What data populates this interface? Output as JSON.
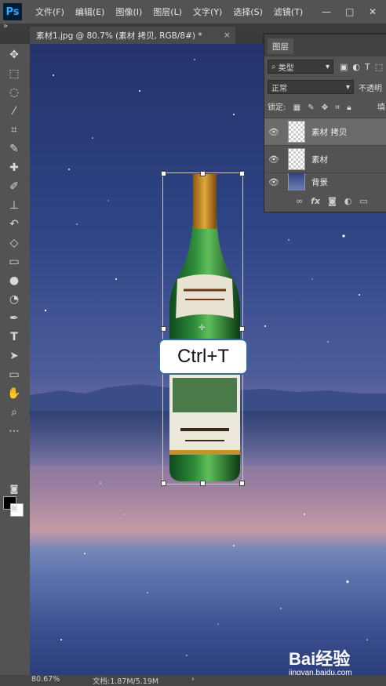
{
  "menubar": {
    "logo": "Ps",
    "items": [
      "文件(F)",
      "编辑(E)",
      "图像(I)",
      "图层(L)",
      "文字(Y)",
      "选择(S)",
      "滤镜(T)"
    ],
    "minimize": "—",
    "restore": "□",
    "close": "✕"
  },
  "toolbar": {
    "collapse": "»",
    "tools": [
      "move-tool-icon",
      "marquee-tool-icon",
      "lasso-tool-icon",
      "quick-select-tool-icon",
      "crop-tool-icon",
      "eyedropper-tool-icon",
      "healing-brush-tool-icon",
      "brush-tool-icon",
      "stamp-tool-icon",
      "history-brush-tool-icon",
      "eraser-tool-icon",
      "gradient-tool-icon",
      "blur-tool-icon",
      "dodge-tool-icon",
      "pen-tool-icon",
      "type-tool-icon",
      "path-select-tool-icon",
      "rectangle-tool-icon",
      "hand-tool-icon",
      "zoom-tool-icon",
      "more-tools-icon"
    ]
  },
  "document": {
    "tab_title": "素材1.jpg @ 80.7% (素材 拷贝, RGB/8#) *",
    "tab_close": "×"
  },
  "overlay": {
    "shortcut": "Ctrl+T"
  },
  "layers_panel": {
    "tab": "图层",
    "filter_label": "类型",
    "blend_mode": "正常",
    "opacity_label": "不透明",
    "lock_label": "锁定:",
    "fill_label": "填",
    "layers": [
      {
        "name": "素材 拷贝",
        "selected": true
      },
      {
        "name": "素材",
        "selected": false
      },
      {
        "name": "背景",
        "selected": false
      }
    ],
    "footer_icons": [
      "link-icon",
      "fx-icon",
      "mask-icon",
      "adjustment-icon",
      "folder-icon"
    ]
  },
  "statusbar": {
    "zoom": "80.67%",
    "doc_info": "文档:1.87M/5.19M"
  },
  "watermark": {
    "brand": "Bai经验",
    "url": "jingyan.baidu.com"
  }
}
